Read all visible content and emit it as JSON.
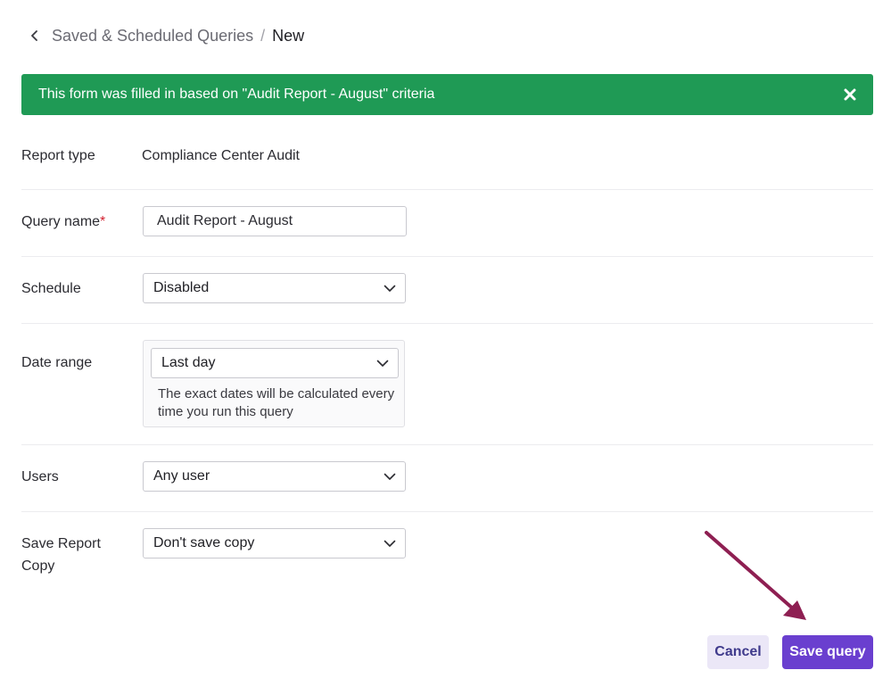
{
  "breadcrumb": {
    "parent": "Saved & Scheduled Queries",
    "separator": "/",
    "current": "New"
  },
  "banner": {
    "message": "This form was filled in based on \"Audit Report - August\" criteria",
    "color": "#1f9a55"
  },
  "form": {
    "report_type": {
      "label": "Report type",
      "value": "Compliance Center Audit"
    },
    "query_name": {
      "label": "Query name",
      "required_mark": "*",
      "value": "Audit Report - August"
    },
    "schedule": {
      "label": "Schedule",
      "selected": "Disabled"
    },
    "date_range": {
      "label": "Date range",
      "selected": "Last day",
      "hint": "The exact dates will be calculated every time you run this query"
    },
    "users": {
      "label": "Users",
      "selected": "Any user"
    },
    "save_report_copy": {
      "label": "Save Report Copy",
      "selected": "Don't save copy"
    }
  },
  "buttons": {
    "cancel": "Cancel",
    "save": "Save query"
  },
  "colors": {
    "accent": "#6a3fcf",
    "annotation_arrow": "#8e1f52",
    "required": "#d21f2e"
  }
}
